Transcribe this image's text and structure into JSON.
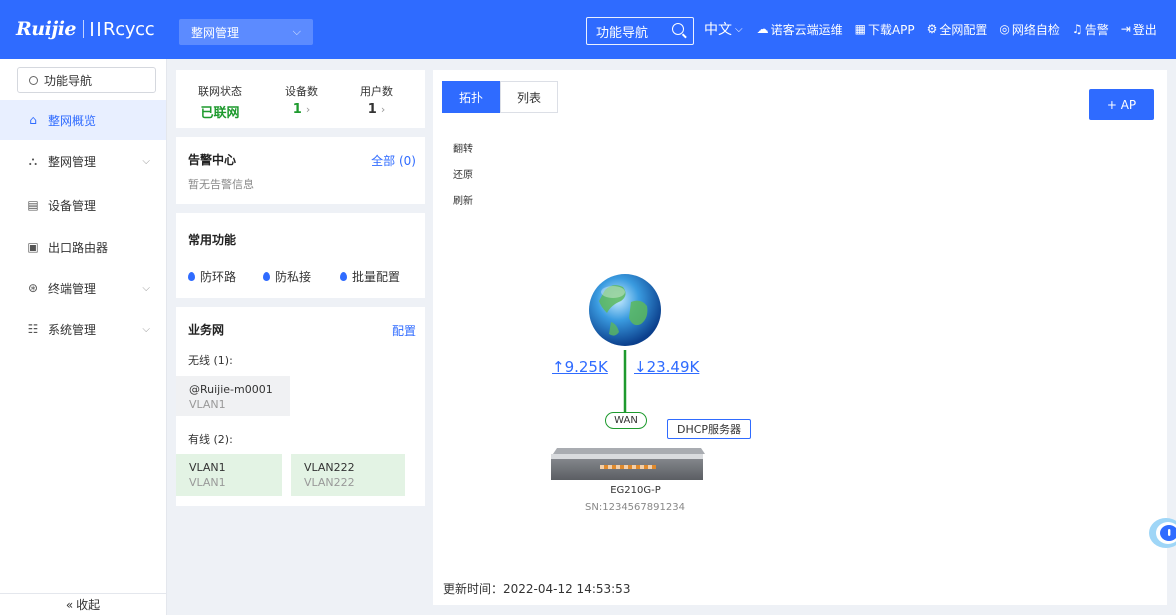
{
  "header": {
    "brand_left": "Ruijie",
    "brand_right": "Rcycc",
    "network_select": "整网管理",
    "search_label": "功能导航",
    "language": "中文",
    "actions": [
      "诺客云端运维",
      "下载APP",
      "全网配置",
      "网络自检",
      "告警",
      "登出"
    ]
  },
  "sidebar": {
    "search_label": "功能导航",
    "items": [
      {
        "label": "整网概览",
        "icon": "home-icon",
        "active": true
      },
      {
        "label": "整网管理",
        "icon": "network-icon",
        "expandable": true
      },
      {
        "label": "设备管理",
        "icon": "device-icon"
      },
      {
        "label": "出口路由器",
        "icon": "router-icon"
      },
      {
        "label": "终端管理",
        "icon": "terminal-icon",
        "expandable": true
      },
      {
        "label": "系统管理",
        "icon": "settings-icon",
        "expandable": true
      }
    ],
    "collapse_label": "收起"
  },
  "stats": {
    "status_label": "联网状态",
    "status_value": "已联网",
    "devices_label": "设备数",
    "devices_value": "1",
    "users_label": "用户数",
    "users_value": "1"
  },
  "alarm_center": {
    "title": "告警中心",
    "link": "全部 (0)",
    "empty": "暂无告警信息"
  },
  "common_functions": {
    "title": "常用功能",
    "items": [
      "防环路",
      "防私接",
      "批量配置"
    ]
  },
  "business_network": {
    "title": "业务网",
    "link": "配置",
    "wireless_label": "无线 (1):",
    "wireless": [
      {
        "name": "@Ruijie-m0001",
        "vlan": "VLAN1"
      }
    ],
    "wired_label": "有线 (2):",
    "wired": [
      {
        "name": "VLAN1",
        "vlan": "VLAN1"
      },
      {
        "name": "VLAN222",
        "vlan": "VLAN222"
      }
    ]
  },
  "topology": {
    "tabs": [
      "拓扑",
      "列表"
    ],
    "active_tab": "拓扑",
    "add_ap": "+ AP",
    "tools": [
      "翻转",
      "还原",
      "刷新"
    ],
    "upload": "↑9.25K",
    "download": "↓23.49K",
    "wan_label": "WAN",
    "dhcp_label": "DHCP服务器",
    "device_name": "EG210G-P",
    "device_sn": "SN:1234567891234",
    "update_time": "更新时间：2022-04-12 14:53:53"
  },
  "colors": {
    "primary": "#2f6bff",
    "success": "#1e9a2e",
    "sidebar_active_bg": "#e8efff"
  }
}
